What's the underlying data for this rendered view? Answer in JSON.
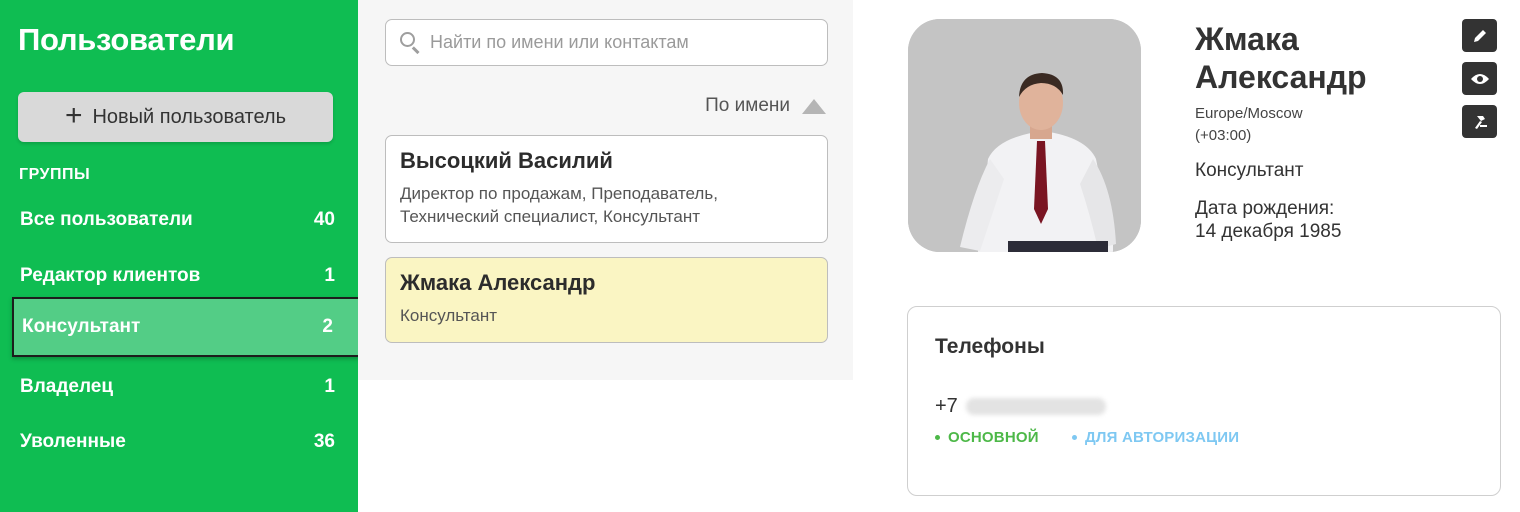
{
  "sidebar": {
    "title": "Пользователи",
    "new_user_label": "Новый пользователь",
    "groups_heading": "ГРУППЫ",
    "groups": [
      {
        "label": "Все пользователи",
        "count": "40"
      },
      {
        "label": "Редактор клиентов",
        "count": "1"
      },
      {
        "label": "Консультант",
        "count": "2",
        "active": true
      },
      {
        "label": "Владелец",
        "count": "1"
      },
      {
        "label": "Уволенные",
        "count": "36"
      }
    ],
    "background_color": "#0fbd52",
    "active_color": "#53cd86"
  },
  "list": {
    "search_placeholder": "Найти по имени или контактам",
    "search_value": "",
    "sort_label": "По имени",
    "users": [
      {
        "name": "Высоцкий Василий",
        "roles": "Директор по продажам, Преподаватель, Технический специалист, Консультант"
      },
      {
        "name": "Жмака Александр",
        "roles": "Консультант",
        "selected": true
      }
    ],
    "selected_color": "#faf5c3"
  },
  "profile": {
    "name": "Жмака Александр",
    "timezone": "Europe/Moscow",
    "utc_offset": "(+03:00)",
    "role": "Консультант",
    "birthday_label": "Дата рождения:",
    "birthday_value": "14 декабря 1985",
    "actions": [
      "edit-icon",
      "eye-icon",
      "hammer-icon"
    ],
    "phones": {
      "title": "Телефоны",
      "prefix": "+7",
      "tags": [
        {
          "label": "ОСНОВНОЙ",
          "color": "#4db848"
        },
        {
          "label": "ДЛЯ АВТОРИЗАЦИИ",
          "color": "#7ec8f2"
        }
      ]
    }
  }
}
